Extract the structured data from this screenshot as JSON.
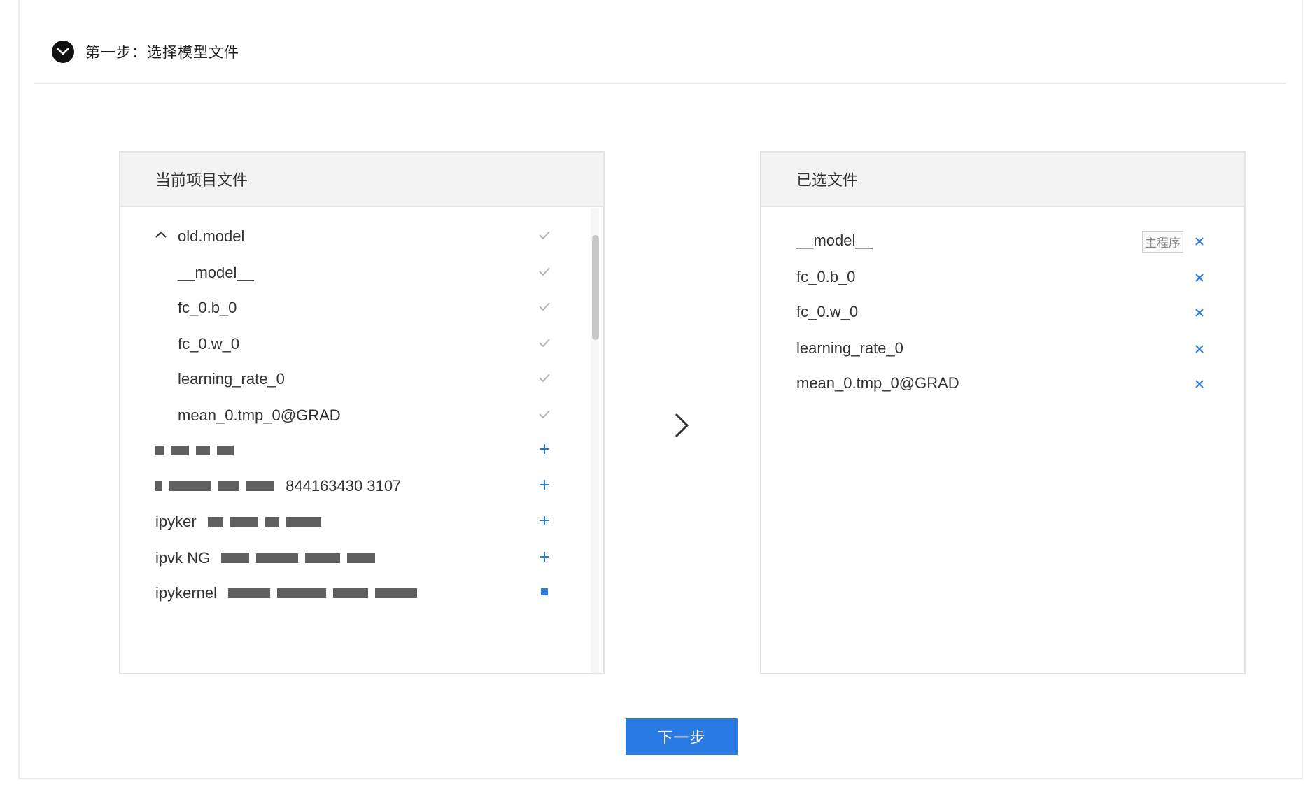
{
  "step": {
    "title": "第一步：选择模型文件"
  },
  "left_panel": {
    "title": "当前项目文件",
    "folder": {
      "name": "old.model",
      "expanded": true,
      "icon": "chevron-up-icon"
    },
    "children": [
      {
        "name": "__model__",
        "state": "selected",
        "icon": "check-icon"
      },
      {
        "name": "fc_0.b_0",
        "state": "selected",
        "icon": "check-icon"
      },
      {
        "name": "fc_0.w_0",
        "state": "selected",
        "icon": "check-icon"
      },
      {
        "name": "learning_rate_0",
        "state": "selected",
        "icon": "check-icon"
      },
      {
        "name": "mean_0.tmp_0@GRAD",
        "state": "selected",
        "icon": "check-icon"
      }
    ],
    "others": [
      {
        "name": "",
        "icon": "plus-icon"
      },
      {
        "name": "844163430 3107",
        "icon": "plus-icon"
      },
      {
        "name": "ipyker",
        "icon": "plus-icon"
      },
      {
        "name": "ipvk NG",
        "icon": "plus-icon"
      },
      {
        "name": "ipykernel",
        "icon": "plus-icon"
      }
    ]
  },
  "right_panel": {
    "title": "已选文件",
    "items": [
      {
        "name": "__model__",
        "badge": "主程序",
        "icon": "close-icon"
      },
      {
        "name": "fc_0.b_0",
        "badge": "",
        "icon": "close-icon"
      },
      {
        "name": "fc_0.w_0",
        "badge": "",
        "icon": "close-icon"
      },
      {
        "name": "learning_rate_0",
        "badge": "",
        "icon": "close-icon"
      },
      {
        "name": "mean_0.tmp_0@GRAD",
        "badge": "",
        "icon": "close-icon"
      }
    ]
  },
  "actions": {
    "next_label": "下一步"
  },
  "colors": {
    "accent": "#2a7ae4",
    "check": "#b5b5b5",
    "header_bg": "#f3f3f3"
  }
}
